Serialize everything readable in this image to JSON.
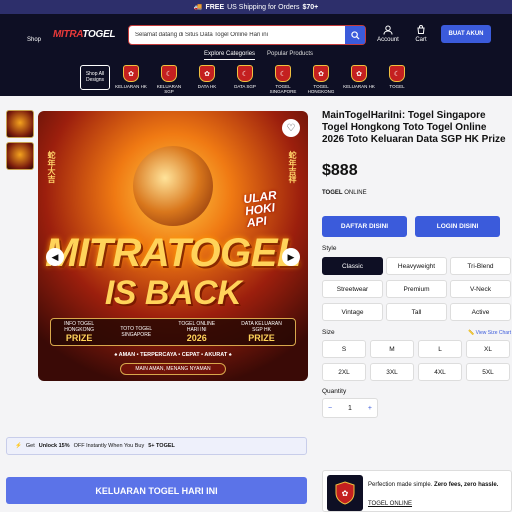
{
  "promo": {
    "prefix": "FREE",
    "text": "US Shipping for Orders",
    "amount": "$70+"
  },
  "header": {
    "shop_label": "Shop",
    "logo_left": "MITRA",
    "logo_right": "TOGEL",
    "search_value": "Selamat datang di Situs Data Togel Online Hari ini",
    "account_label": "Account",
    "cart_label": "Cart",
    "cta_label": "BUAT AKUN",
    "nav": [
      "Explore Categories",
      "Popular Products"
    ]
  },
  "categories": {
    "all_label_1": "Shop All",
    "all_label_2": "Designs",
    "items": [
      "KELUARAN HK",
      "KELUARAN SGP",
      "DATA HK",
      "DATA SGP",
      "TOGEL SINGAPORE",
      "TOGEL HONGKONG",
      "KELUARAN HK",
      "TOGEL"
    ]
  },
  "hero": {
    "side_left": "蛇年大吉",
    "side_right": "蛇年吉祥",
    "badge_1": "ULAR",
    "badge_2": "HOKI",
    "badge_3": "API",
    "line1": "MITRATOGEL",
    "line2": "IS BACK",
    "info": [
      {
        "small": "INFO TOGEL",
        "small2": "HONGKONG",
        "big": "PRIZE"
      },
      {
        "small": "TOTO TOGEL",
        "small2": "SINGAPORE",
        "big": ""
      },
      {
        "small": "TOGEL ONLINE",
        "small2": "HARI INI",
        "big": "2026"
      },
      {
        "small": "DATA KELUARAN",
        "small2": "SGP HK",
        "big": "PRIZE"
      }
    ],
    "tagline": "♠ AMAN • TERPERCAYA • CEPAT • AKURAT ♠",
    "subtag": "MAIN AMAN, MENANG NYAMAN"
  },
  "product": {
    "title": "MainTogelHariIni: Togel Singapore Togel Hongkong Toto Togel Online 2026 Toto Keluaran Data SGP HK Prize",
    "price": "$888",
    "vendor_bold": "TOGEL",
    "vendor_rest": "ONLINE",
    "btn_daftar": "DAFTAR DISINI",
    "btn_login": "LOGIN DISINI",
    "style_label": "Style",
    "styles": [
      "Classic",
      "Heavyweight",
      "Tri-Blend",
      "Streetwear",
      "Premium",
      "V-Neck",
      "Vintage",
      "Tall",
      "Active"
    ],
    "size_label": "Size",
    "size_chart": "View Size Chart",
    "sizes": [
      "S",
      "M",
      "L",
      "XL",
      "2XL",
      "3XL",
      "4XL",
      "5XL"
    ],
    "qty_label": "Quantity",
    "qty_minus": "−",
    "qty_value": "1",
    "qty_plus": "+"
  },
  "unlock": {
    "pre": "Get",
    "bold1": "Unlock 15%",
    "mid": "OFF Instantly When You Buy",
    "bold2": "5+ TOGEL"
  },
  "bigbtn": "KELUARAN TOGEL HARI INI",
  "card": {
    "text": "Perfection made simple.",
    "bold": "Zero fees, zero hassle.",
    "link": "TOGEL ONLINE"
  },
  "colors": {
    "navy": "#0e0f24",
    "accent": "#3b5bdb",
    "red": "#c42020",
    "gold": "#ffd35a"
  }
}
